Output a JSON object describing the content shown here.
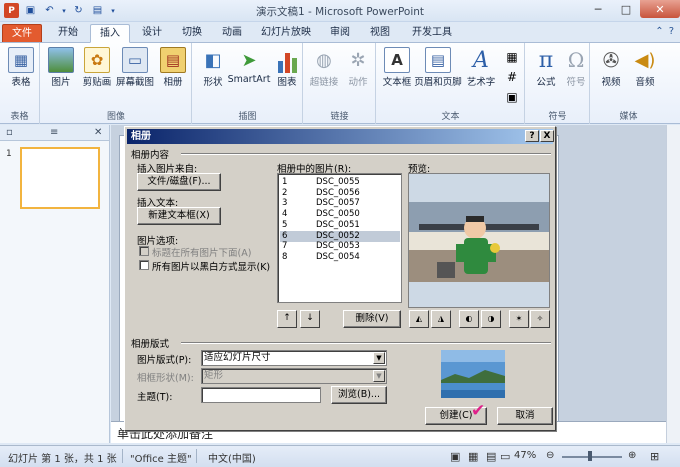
{
  "titlebar": {
    "title": "演示文稿1 - Microsoft PowerPoint"
  },
  "tabs": [
    "文件",
    "开始",
    "插入",
    "设计",
    "切换",
    "动画",
    "幻灯片放映",
    "审阅",
    "视图",
    "开发工具"
  ],
  "ribbon": {
    "groups": {
      "tables": {
        "label": "表格",
        "buttons": [
          "表格"
        ]
      },
      "images": {
        "label": "图像",
        "buttons": [
          "图片",
          "剪贴画",
          "屏幕截图",
          "相册"
        ]
      },
      "illustrations": {
        "label": "插图",
        "buttons": [
          "形状",
          "SmartArt",
          "图表"
        ]
      },
      "links": {
        "label": "链接",
        "buttons": [
          "超链接",
          "动作"
        ]
      },
      "text": {
        "label": "文本",
        "buttons": [
          "文本框",
          "页眉和页脚",
          "艺术字"
        ]
      },
      "symbols": {
        "label": "符号",
        "buttons": [
          "公式",
          "符号"
        ]
      },
      "media": {
        "label": "媒体",
        "buttons": [
          "视频",
          "音频"
        ]
      }
    }
  },
  "leftpane": {
    "slide_number": "1"
  },
  "notes": {
    "placeholder": "单击此处添加备注"
  },
  "statusbar": {
    "slide": "幻灯片 第 1 张，共 1 张",
    "theme": "\"Office 主题\"",
    "lang": "中文(中国)",
    "zoom": "47%"
  },
  "dialog": {
    "title": "相册",
    "help": "?",
    "close": "X",
    "content_label": "相册内容",
    "insert_from": "插入图片来自:",
    "file_disk_button": "文件/磁盘(F)...",
    "insert_text": "插入文本:",
    "new_textbox_button": "新建文本框(X)",
    "picture_options": "图片选项:",
    "caption_below": "标题在所有图片下面(A)",
    "black_white": "所有图片以黑白方式显示(K)",
    "list_label": "相册中的图片(R):",
    "pictures": [
      {
        "n": "1",
        "name": "DSC_0055"
      },
      {
        "n": "2",
        "name": "DSC_0056"
      },
      {
        "n": "3",
        "name": "DSC_0057"
      },
      {
        "n": "4",
        "name": "DSC_0050"
      },
      {
        "n": "5",
        "name": "DSC_0051"
      },
      {
        "n": "6",
        "name": "DSC_0052"
      },
      {
        "n": "7",
        "name": "DSC_0053"
      },
      {
        "n": "8",
        "name": "DSC_0054"
      }
    ],
    "selected_index": 5,
    "up": "↑",
    "down": "↓",
    "remove_button": "删除(V)",
    "preview_label": "预览:",
    "layout_label": "相册版式",
    "picture_layout": "图片版式(P):",
    "picture_layout_value": "适应幻灯片尺寸",
    "frame_shape": "相框形状(M):",
    "frame_shape_value": "矩形",
    "theme": "主题(T):",
    "theme_value": "",
    "browse_button": "浏览(B)...",
    "create_button": "创建(C)",
    "cancel_button": "取消"
  },
  "colors": {
    "file_tab": "#e35b2f",
    "dialog_title": "#0a246a",
    "selection": "#c1cbd8"
  }
}
